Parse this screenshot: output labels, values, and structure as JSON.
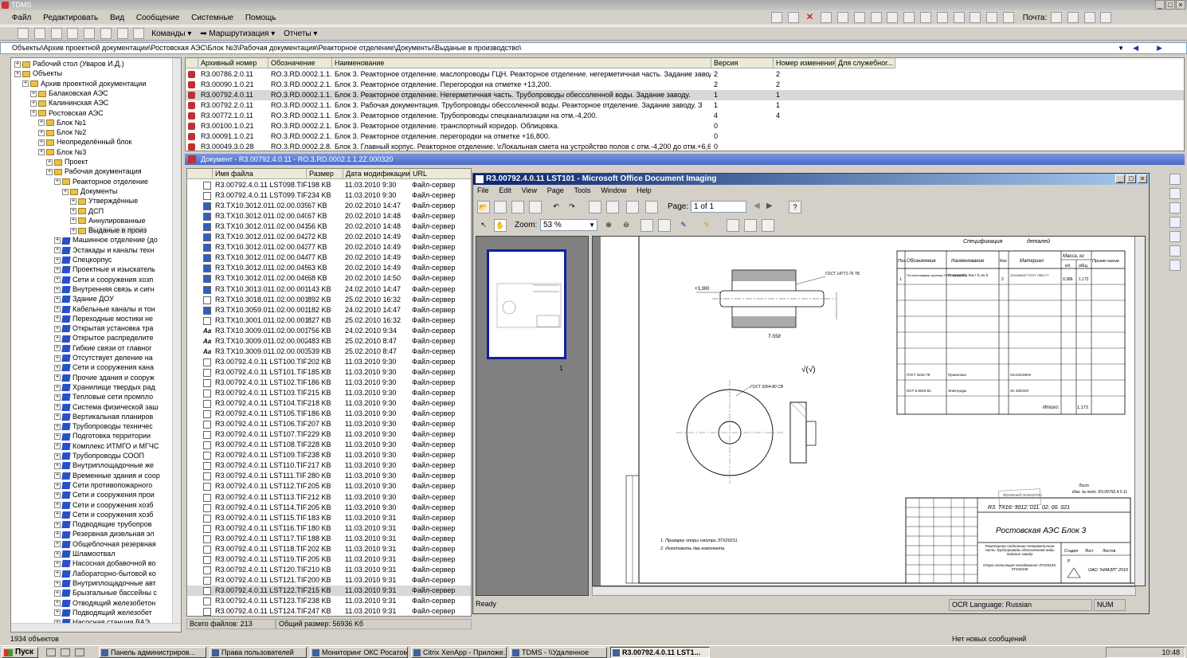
{
  "app": {
    "title": "TDMS"
  },
  "menu": [
    "Файл",
    "Редактировать",
    "Вид",
    "Сообщение",
    "Системные",
    "Помощь"
  ],
  "toolbar": {
    "commands": "Команды",
    "routing": "Маршрутизация",
    "reports": "Отчеты",
    "mail": "Почта:"
  },
  "address": "Объекты\\Архив проектной документации\\Ростовская АЭС\\Блок №3\\Рабочая документация\\Реакторное отделение\\Документы\\Выданые в производство\\",
  "tree": [
    {
      "t": "Рабочий стол (Уваров И.Д.)",
      "l": 0,
      "i": "fld"
    },
    {
      "t": "Объекты",
      "l": 0,
      "i": "fld"
    },
    {
      "t": "Архив проектной документации",
      "l": 1,
      "i": "fld"
    },
    {
      "t": "Балаковская АЭС",
      "l": 2,
      "i": "fld"
    },
    {
      "t": "Калининская АЭС",
      "l": 2,
      "i": "fld"
    },
    {
      "t": "Ростовская АЭС",
      "l": 2,
      "i": "fld"
    },
    {
      "t": "Блок №1",
      "l": 3,
      "i": "fld"
    },
    {
      "t": "Блок №2",
      "l": 3,
      "i": "fld"
    },
    {
      "t": "Неопределённый блок",
      "l": 3,
      "i": "fld"
    },
    {
      "t": "Блок №3",
      "l": 3,
      "i": "fld"
    },
    {
      "t": "Проект",
      "l": 4,
      "i": "fld"
    },
    {
      "t": "Рабочая документация",
      "l": 4,
      "i": "fld"
    },
    {
      "t": "Реакторное отделение",
      "l": 5,
      "i": "fld"
    },
    {
      "t": "Документы",
      "l": 6,
      "i": "fld"
    },
    {
      "t": "Утверждённые",
      "l": 7,
      "i": "fld"
    },
    {
      "t": "ДСП",
      "l": 7,
      "i": "fld"
    },
    {
      "t": "Аннулированные",
      "l": 7,
      "i": "fld"
    },
    {
      "t": "Выданые в произ",
      "l": 7,
      "i": "fld"
    },
    {
      "t": "Машинное отделение (до",
      "l": 5,
      "i": "blu"
    },
    {
      "t": "Эстакады и каналы техн",
      "l": 5,
      "i": "blu"
    },
    {
      "t": "Спецкорпус",
      "l": 5,
      "i": "blu"
    },
    {
      "t": "Проектные и изыскатель",
      "l": 5,
      "i": "blu"
    },
    {
      "t": "Сети и сооружения хозп",
      "l": 5,
      "i": "blu"
    },
    {
      "t": "Внутренняя связь и сигн",
      "l": 5,
      "i": "blu"
    },
    {
      "t": "Здание ДОУ",
      "l": 5,
      "i": "blu"
    },
    {
      "t": "Кабельные каналы и тон",
      "l": 5,
      "i": "blu"
    },
    {
      "t": "Переходные мостики не",
      "l": 5,
      "i": "blu"
    },
    {
      "t": "Открытая установка тра",
      "l": 5,
      "i": "blu"
    },
    {
      "t": "Открытое распределите",
      "l": 5,
      "i": "blu"
    },
    {
      "t": "Гибкие связи от главног",
      "l": 5,
      "i": "blu"
    },
    {
      "t": "Отсутствует деление на",
      "l": 5,
      "i": "blu"
    },
    {
      "t": "Сети и сооружения кана",
      "l": 5,
      "i": "blu"
    },
    {
      "t": "Прочие здания и сооруж",
      "l": 5,
      "i": "blu"
    },
    {
      "t": "Хранилище твердых рад",
      "l": 5,
      "i": "blu"
    },
    {
      "t": "Тепловые сети промпло",
      "l": 5,
      "i": "blu"
    },
    {
      "t": "Система физической заш",
      "l": 5,
      "i": "blu"
    },
    {
      "t": "Вертикальная планиров",
      "l": 5,
      "i": "blu"
    },
    {
      "t": "Трубопроводы техничес",
      "l": 5,
      "i": "blu"
    },
    {
      "t": "Подготовка территории",
      "l": 5,
      "i": "blu"
    },
    {
      "t": "Комплекс ИТМГО и МГЧС",
      "l": 5,
      "i": "blu"
    },
    {
      "t": "Трубопроводы СООП",
      "l": 5,
      "i": "blu"
    },
    {
      "t": "Внутриплощадочные же",
      "l": 5,
      "i": "blu"
    },
    {
      "t": "Временные здания и соор",
      "l": 5,
      "i": "blu"
    },
    {
      "t": "Сети противопожарного",
      "l": 5,
      "i": "blu"
    },
    {
      "t": "Сети и сооружения прои",
      "l": 5,
      "i": "blu"
    },
    {
      "t": "Сети и сооружения хозб",
      "l": 5,
      "i": "blu"
    },
    {
      "t": "Сети и сооружения хозб",
      "l": 5,
      "i": "blu"
    },
    {
      "t": "Подводящие трубопров",
      "l": 5,
      "i": "blu"
    },
    {
      "t": "Резервная дизельная эл",
      "l": 5,
      "i": "blu"
    },
    {
      "t": "Общеблочная резервная",
      "l": 5,
      "i": "blu"
    },
    {
      "t": "Шламоотвал",
      "l": 5,
      "i": "blu"
    },
    {
      "t": "Насосная добавочной во",
      "l": 5,
      "i": "blu"
    },
    {
      "t": "Лабораторно-бытовой ко",
      "l": 5,
      "i": "blu"
    },
    {
      "t": "Внутриплощадочные авт",
      "l": 5,
      "i": "blu"
    },
    {
      "t": "Брызгальные бассейны с",
      "l": 5,
      "i": "blu"
    },
    {
      "t": "Отводящий железобетон",
      "l": 5,
      "i": "blu"
    },
    {
      "t": "Подводящий железобет",
      "l": 5,
      "i": "blu"
    },
    {
      "t": "Насосная станция ВАЭ",
      "l": 5,
      "i": "blu"
    }
  ],
  "status_objects": "1934 объектов",
  "topgrid": {
    "headers": [
      "Архивный номер",
      "Обозначение",
      "Наименование",
      "Версия",
      "Номер изменения",
      "Для служебног..."
    ],
    "rows": [
      [
        "R3.00786.2.0.11",
        "RO.3.RD.0002.1.1.",
        "Блок 3. Реакторное отделение. маслопроводы ГЦН. Реакторное отделение. негерметичная часть. Задание заводу. Св",
        "2",
        "2"
      ],
      [
        "R3.00090.1.0.21",
        "RO.3.RD.0002.2.1.",
        "Блок 3. Реакторное отделение. Перегородки на отметке +13,200.",
        "2",
        "2"
      ],
      [
        "R3.00792.4.0.11",
        "RO.3.RD.0002.1.1.",
        "Блок 3. Реакторное отделение. Негерметичная часть. Трубопроводы обессоленной воды. Задание заводу.",
        "1",
        "1"
      ],
      [
        "R3.00792.2.0.11",
        "RO.3.RD.0002.1.1.",
        "Блок 3. Рабочая документация. Трубопроводы обессоленной воды. Реакторное отделение. Задание заводу. З",
        "1",
        "1"
      ],
      [
        "R3.00772.1.0.11",
        "RO.3.RD.0002.1.1.",
        "Блок 3. Реакторное отделение. Трубопроводы спецканализации на отм.-4,200.",
        "4",
        "4"
      ],
      [
        "R3.00100.1.0.21",
        "RO.3.RD.0002.2.1.",
        "Блок 3. Реакторное отделение. транспортный коридор. Облицовка.",
        "0",
        ""
      ],
      [
        "R3.00091.1.0.21",
        "RO.3.RD.0002.2.1.",
        "Блок 3. Реакторное отделение. перегородки на отметке +16,800.",
        "0",
        ""
      ],
      [
        "R3.00049.3.0.28",
        "RO.3.RD.0002.2.8.",
        "Блок 3. Главный корпус. Реакторное отделение. \\rЛокальная смета на устройство полов с отм.-4,200 до отм.+6,600",
        "0",
        ""
      ]
    ]
  },
  "docbar": "Документ - R3.00792.4.0.11 - RO.3.RD.0002.1.1.2Z.000320",
  "files": {
    "headers": [
      "Имя файла",
      "Размер",
      "Дата модификации",
      "URL"
    ],
    "rows": [
      [
        "R3.00792.4.0.11 LST098.TIF",
        "198 KB",
        "11.03.2010 9:30",
        "Файл-сервер",
        "f"
      ],
      [
        "R3.00792.4.0.11 LST099.TIF",
        "234 KB",
        "11.03.2010 9:30",
        "Файл-сервер",
        "f"
      ],
      [
        "R3.TX10.3012.011.02.00.039",
        "67 KB",
        "20.02.2010 14:47",
        "Файл-сервер",
        "b"
      ],
      [
        "R3.TX10.3012.011.02.00.040",
        "67 KB",
        "20.02.2010 14:48",
        "Файл-сервер",
        "b"
      ],
      [
        "R3.TX10.3012.011.02.00.041",
        "56 KB",
        "20.02.2010 14:48",
        "Файл-сервер",
        "b"
      ],
      [
        "R3.TX10.3012.011.02.00.042",
        "72 KB",
        "20.02.2010 14:49",
        "Файл-сервер",
        "b"
      ],
      [
        "R3.TX10.3012.011.02.00.043",
        "77 KB",
        "20.02.2010 14:49",
        "Файл-сервер",
        "b"
      ],
      [
        "R3.TX10.3012.011.02.00.044",
        "77 KB",
        "20.02.2010 14:49",
        "Файл-сервер",
        "b"
      ],
      [
        "R3.TX10.3012.011.02.00.045",
        "63 KB",
        "20.02.2010 14:49",
        "Файл-сервер",
        "b"
      ],
      [
        "R3.TX10.3012.011.02.00.046",
        "68 KB",
        "20.02.2010 14:50",
        "Файл-сервер",
        "b"
      ],
      [
        "R3.TX10.3013.011.02.00.001",
        "143 KB",
        "24.02.2010 14:47",
        "Файл-сервер",
        "b"
      ],
      [
        "R3.TX10.3018.011.02.00.001",
        "892 KB",
        "25.02.2010 16:32",
        "Файл-сервер",
        "f"
      ],
      [
        "R3.TX10.3059.011.02.00.001",
        "182 KB",
        "24.02.2010 14:47",
        "Файл-сервер",
        "b"
      ],
      [
        "R3.TX10.3001.011.02.00.001",
        "827 KB",
        "25.02.2010 16:32",
        "Файл-сервер",
        "f"
      ],
      [
        "R3.TX10.3009.011.02.00.001",
        "756 KB",
        "24.02.2010 9:34",
        "Файл-сервер",
        "a"
      ],
      [
        "R3.TX10.3009.011.02.00.002",
        "483 KB",
        "25.02.2010 8:47",
        "Файл-сервер",
        "a"
      ],
      [
        "R3.TX10.3009.011.02.00.003",
        "539 KB",
        "25.02.2010 8:47",
        "Файл-сервер",
        "a"
      ],
      [
        "R3.00792.4.0.11 LST100.TIF",
        "202 KB",
        "11.03.2010 9:30",
        "Файл-сервер",
        "f"
      ],
      [
        "R3.00792.4.0.11 LST101.TIF",
        "185 KB",
        "11.03.2010 9:30",
        "Файл-сервер",
        "f"
      ],
      [
        "R3.00792.4.0.11 LST102.TIF",
        "186 KB",
        "11.03.2010 9:30",
        "Файл-сервер",
        "f"
      ],
      [
        "R3.00792.4.0.11 LST103.TIF",
        "215 KB",
        "11.03.2010 9:30",
        "Файл-сервер",
        "f"
      ],
      [
        "R3.00792.4.0.11 LST104.TIF",
        "218 KB",
        "11.03.2010 9:30",
        "Файл-сервер",
        "f"
      ],
      [
        "R3.00792.4.0.11 LST105.TIF",
        "186 KB",
        "11.03.2010 9:30",
        "Файл-сервер",
        "f"
      ],
      [
        "R3.00792.4.0.11 LST106.TIF",
        "207 KB",
        "11.03.2010 9:30",
        "Файл-сервер",
        "f"
      ],
      [
        "R3.00792.4.0.11 LST107.TIF",
        "229 KB",
        "11.03.2010 9:30",
        "Файл-сервер",
        "f"
      ],
      [
        "R3.00792.4.0.11 LST108.TIF",
        "228 KB",
        "11.03.2010 9:30",
        "Файл-сервер",
        "f"
      ],
      [
        "R3.00792.4.0.11 LST109.TIF",
        "238 KB",
        "11.03.2010 9:30",
        "Файл-сервер",
        "f"
      ],
      [
        "R3.00792.4.0.11 LST110.TIF",
        "217 KB",
        "11.03.2010 9:30",
        "Файл-сервер",
        "f"
      ],
      [
        "R3.00792.4.0.11 LST111.TIF",
        "280 KB",
        "11.03.2010 9:30",
        "Файл-сервер",
        "f"
      ],
      [
        "R3.00792.4.0.11 LST112.TIF",
        "205 KB",
        "11.03.2010 9:30",
        "Файл-сервер",
        "f"
      ],
      [
        "R3.00792.4.0.11 LST113.TIF",
        "212 KB",
        "11.03.2010 9:30",
        "Файл-сервер",
        "f"
      ],
      [
        "R3.00792.4.0.11 LST114.TIF",
        "205 KB",
        "11.03.2010 9:30",
        "Файл-сервер",
        "f"
      ],
      [
        "R3.00792.4.0.11 LST115.TIF",
        "183 KB",
        "11.03.2010 9:31",
        "Файл-сервер",
        "f"
      ],
      [
        "R3.00792.4.0.11 LST116.TIF",
        "180 KB",
        "11.03.2010 9:31",
        "Файл-сервер",
        "f"
      ],
      [
        "R3.00792.4.0.11 LST117.TIF",
        "188 KB",
        "11.03.2010 9:31",
        "Файл-сервер",
        "f"
      ],
      [
        "R3.00792.4.0.11 LST118.TIF",
        "202 KB",
        "11.03.2010 9:31",
        "Файл-сервер",
        "f"
      ],
      [
        "R3.00792.4.0.11 LST119.TIF",
        "205 KB",
        "11.03.2010 9:31",
        "Файл-сервер",
        "f"
      ],
      [
        "R3.00792.4.0.11 LST120.TIF",
        "210 KB",
        "11.03.2010 9:31",
        "Файл-сервер",
        "f"
      ],
      [
        "R3.00792.4.0.11 LST121.TIF",
        "200 KB",
        "11.03.2010 9:31",
        "Файл-сервер",
        "f"
      ],
      [
        "R3.00792.4.0.11 LST122.TIF",
        "215 KB",
        "11.03.2010 9:31",
        "Файл-сервер",
        "f"
      ],
      [
        "R3.00792.4.0.11 LST123.TIF",
        "238 KB",
        "11.03.2010 9:31",
        "Файл-сервер",
        "f"
      ],
      [
        "R3.00792.4.0.11 LST124.TIF",
        "247 KB",
        "11.03.2010 9:31",
        "Файл-сервер",
        "f"
      ]
    ],
    "total_files": "Всего файлов: 213",
    "total_size": "Общий размер: 56936 Kб"
  },
  "modi": {
    "title": "R3.00792.4.0.11 LST101 - Microsoft Office Document Imaging",
    "menu": [
      "File",
      "Edit",
      "View",
      "Page",
      "Tools",
      "Window",
      "Help"
    ],
    "page_label": "Page:",
    "page_value": "1 of 1",
    "zoom_label": "Zoom:",
    "zoom_value": "53 %",
    "thumb_num": "1",
    "status_ready": "Ready",
    "status_ocr": "OCR Language: Russian",
    "status_num": "NUM"
  },
  "drawing": {
    "spec_title": "Спецификация",
    "spec_title2": "деталей",
    "cols": [
      "Поз.",
      "Обозначение",
      "Наименование",
      "Кол.",
      "Материал",
      "Масса, кг",
      "Приме-чание"
    ],
    "mass_sub": [
      "ед.",
      "общ."
    ],
    "row1": [
      "1",
      "По настоящему чертежу ГОСТ 19903-74",
      "Полушайба Лист б=4х б",
      "2",
      "12Х18Н10Т ГОСТ 7350-77",
      "0,386",
      "1,172"
    ],
    "row2": [
      "",
      "ГОСТ 3242-79",
      "Проволока",
      "",
      "Св-04Х19Н9",
      "",
      ""
    ],
    "row3": [
      "",
      "ОСТ 5.9010-81",
      "Электроды",
      "",
      "ЗА 400/10У",
      "",
      ""
    ],
    "total": "Итого:",
    "total_val": "1,173",
    "gost1": "ГОСТ 14771-76 ТБ",
    "gost2": "ГОСТ 5264-80 СВ",
    "elev": "+3,300",
    "t558": "Т-558",
    "notes": [
      "1. Приварку опоры смотри ЗТХ20211.",
      "2. Изготовить два комплекта."
    ],
    "stamp_code": "R3. TX10. 3012. 011. 02. 00. 021",
    "stamp_title": "Ростовская АЭС  Блок 3",
    "stamp_org": "ОАО \"НИАЭП\" 2010",
    "archive": "Архивный экземпляр",
    "sheet_label": "Лист",
    "stage_labels": [
      "Стадия",
      "Лист",
      "Листов"
    ],
    "stage_vals": [
      "Р",
      "",
      ""
    ],
    "desc": "Реакторное отделение Негерметичная часть Трубопроводы обессоленной воды Задание заводу",
    "desc2": "Опора скользящая неподвижная ЗТХ20105, ЗТХ20106",
    "inv": "Инв. № подл. R3.00792.4.0.11"
  },
  "msg_status": "Нет новых сообщений",
  "taskbar": {
    "start": "Пуск",
    "tasks": [
      "Панель администриров...",
      "Права пользователей",
      "Мониторинг ОКС Росатом",
      "Citrix XenApp - Приложе...",
      "TDMS - \\\\Удаленное",
      "R3.00792.4.0.11 LST1..."
    ],
    "time": "10:48"
  }
}
